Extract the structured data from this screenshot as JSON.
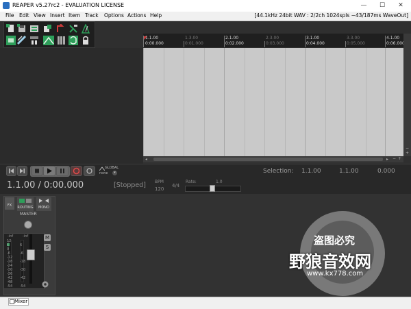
{
  "window": {
    "title": "REAPER v5.27rc2 - EVALUATION LICENSE",
    "min_glyph": "—",
    "max_glyph": "☐",
    "close_glyph": "✕"
  },
  "menubar": {
    "items": [
      "File",
      "Edit",
      "View",
      "Insert",
      "Item",
      "Track",
      "Options",
      "Actions",
      "Help"
    ],
    "audio_status": "[44.1kHz 24bit WAV : 2/2ch 1024spls ~43/187ms WaveOut]"
  },
  "toolbar": {
    "icons": [
      "new-project-icon",
      "save-project-icon",
      "project-settings-icon",
      "undo-icon",
      "redo-icon",
      "metronome-icon",
      "grid-toggle-icon",
      "snap-toggle-icon",
      "ripple-edit-icon",
      "item-grouping-icon",
      "envelope-lock-icon",
      "lock-icon",
      "auto-crossfade-icon"
    ]
  },
  "ruler": {
    "marks": [
      {
        "bar": "1.1.00",
        "time": "0:00.000",
        "major": true
      },
      {
        "bar": "1.3.00",
        "time": "0:01.000",
        "major": false
      },
      {
        "bar": "2.1.00",
        "time": "0:02.000",
        "major": true
      },
      {
        "bar": "2.3.00",
        "time": "0:03.000",
        "major": false
      },
      {
        "bar": "3.1.00",
        "time": "0:04.000",
        "major": true
      },
      {
        "bar": "3.3.00",
        "time": "0:05.000",
        "major": false
      },
      {
        "bar": "4.1.00",
        "time": "0:06.000",
        "major": true
      }
    ]
  },
  "transport": {
    "global_label": "GLOBAL",
    "automation_mode": "none",
    "selection_label": "Selection:",
    "selection_start": "1.1.00",
    "selection_end": "1.1.00",
    "selection_length": "0.000",
    "position": "1.1.00 / 0:00.000",
    "play_state": "[Stopped]",
    "bpm_label": "BPM",
    "bpm": "120",
    "time_signature": "4/4",
    "rate_label": "Rate:",
    "rate_value": "1.0"
  },
  "mixer": {
    "fx_label": "FX",
    "routing_label": "ROUTING",
    "mono_label": "MONO",
    "master_label": "MASTER",
    "meter_left_peak": "-inf",
    "meter_right_peak": "-inf",
    "meter_scale": [
      "12",
      "6",
      "0",
      "-6",
      "-12",
      "-18",
      "-24",
      "-30",
      "-36",
      "-42",
      "-48",
      "-54"
    ],
    "mute_label": "M",
    "solo_label": "S"
  },
  "docker": {
    "tab_label": "Mixer"
  },
  "watermark": {
    "line1": "盗图必究",
    "line2": "野狼音效网",
    "url": "www.kx778.com"
  },
  "colors": {
    "arrange_bg": "#c9c9c9",
    "transport_bg": "#282828",
    "toolbar_green": "#2e9e5a",
    "toolbar_red": "#d13b3b"
  }
}
